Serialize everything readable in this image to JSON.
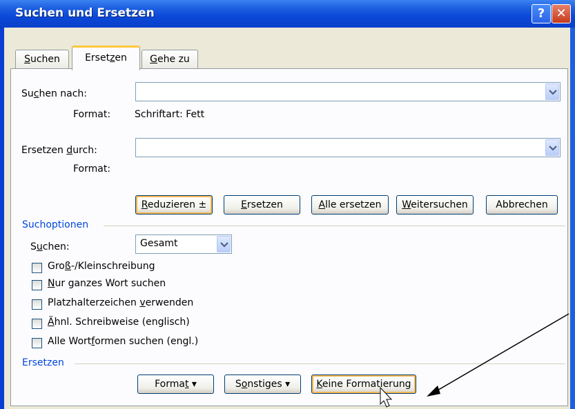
{
  "window": {
    "title": "Suchen und Ersetzen",
    "help_glyph": "?",
    "close_glyph": "✕"
  },
  "tabs": [
    {
      "label_pre": "",
      "label_u": "S",
      "label_post": "uchen"
    },
    {
      "label_pre": "Erset",
      "label_u": "z",
      "label_post": "en"
    },
    {
      "label_pre": "",
      "label_u": "G",
      "label_post": "ehe zu"
    }
  ],
  "find": {
    "label_pre": "Su",
    "label_u": "c",
    "label_post": "hen nach:",
    "value": "",
    "format_label": "Format:",
    "format_value": "Schriftart: Fett"
  },
  "replace": {
    "label_pre": "Ersetzen ",
    "label_u": "d",
    "label_post": "urch:",
    "value": "",
    "format_label": "Format:"
  },
  "buttons": {
    "reduce": {
      "u": "R",
      "post": "eduzieren",
      "glyph": "±"
    },
    "replace": {
      "u": "E",
      "post": "rsetzen"
    },
    "replace_all": {
      "u": "A",
      "post": "lle ersetzen"
    },
    "find_next": {
      "u": "W",
      "post": "eitersuchen"
    },
    "cancel": "Abbrechen"
  },
  "search_options": {
    "heading": "Suchoptionen",
    "direction_label_pre": "S",
    "direction_label_u": "u",
    "direction_label_post": "chen:",
    "direction_value": "Gesamt",
    "checkboxes": [
      {
        "pre": "Gro",
        "u": "ß",
        "post": "-/Kleinschreibung",
        "checked": false
      },
      {
        "pre": "",
        "u": "N",
        "post": "ur ganzes Wort suchen",
        "checked": false
      },
      {
        "pre": "Platzhalterzeichen ",
        "u": "v",
        "post": "erwenden",
        "checked": false
      },
      {
        "pre": "",
        "u": "Ä",
        "post": "hnl. Schreibweise (englisch)",
        "checked": false
      },
      {
        "pre": "Alle Wort",
        "u": "f",
        "post": "ormen suchen (engl.)",
        "checked": false
      }
    ]
  },
  "replace_section": {
    "heading": "Ersetzen",
    "format_btn": {
      "pre": "Forma",
      "u": "t",
      "post": ""
    },
    "special_btn": {
      "pre": "S",
      "u": "o",
      "post": "nstiges"
    },
    "no_format_btn": {
      "pre": "",
      "u": "K",
      "post": "eine Formatierung"
    },
    "dropdown_glyph": "▾"
  }
}
